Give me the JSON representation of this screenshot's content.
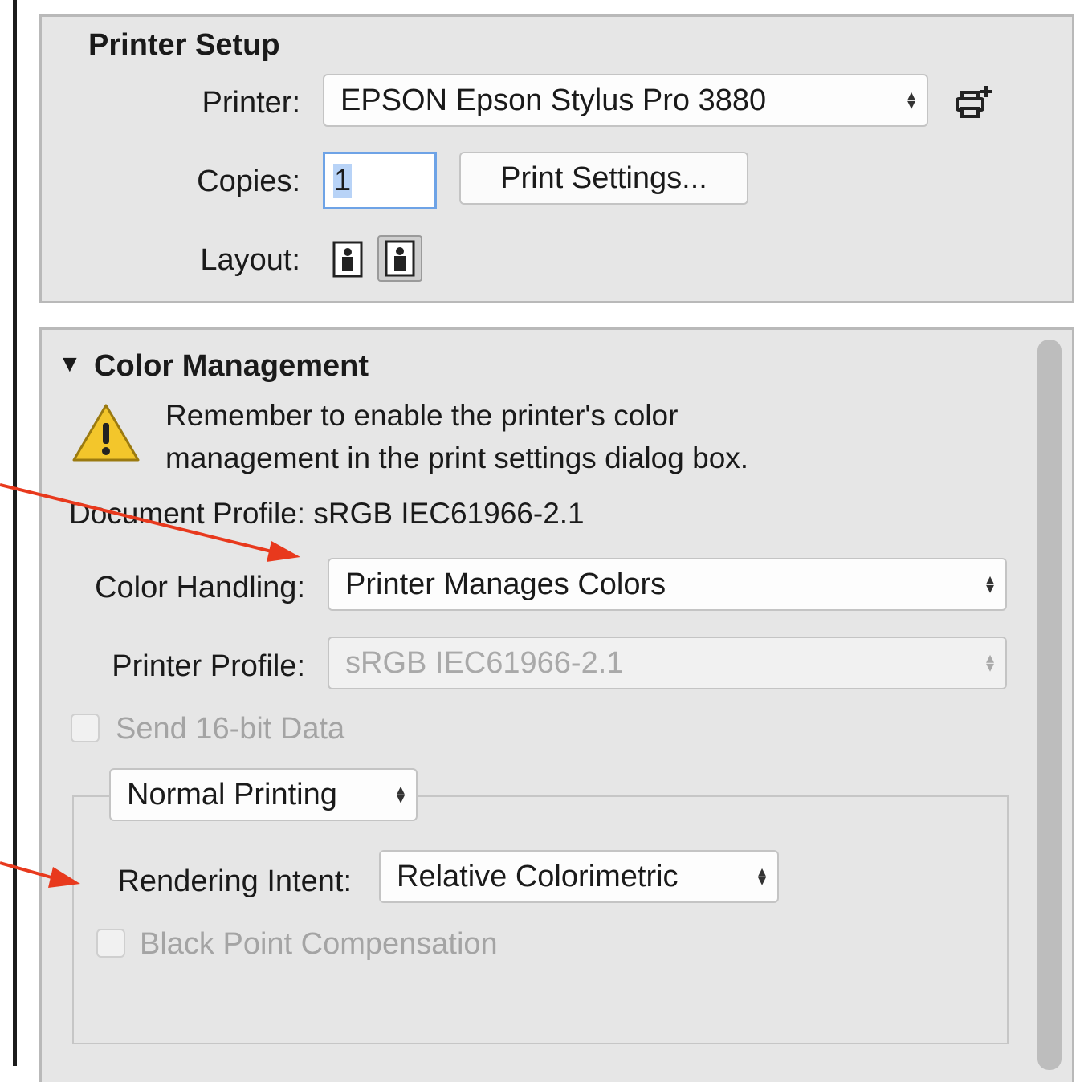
{
  "printer_setup": {
    "title": "Printer Setup",
    "printer_label": "Printer:",
    "printer_value": "EPSON Epson Stylus Pro 3880",
    "copies_label": "Copies:",
    "copies_value": "1",
    "print_settings_label": "Print Settings...",
    "layout_label": "Layout:"
  },
  "color_management": {
    "title": "Color Management",
    "disclosure": "▼",
    "warning_line1": "Remember to enable the printer's color",
    "warning_line2": "management in the print settings dialog box.",
    "document_profile": "Document Profile: sRGB IEC61966-2.1",
    "color_handling_label": "Color Handling:",
    "color_handling_value": "Printer Manages Colors",
    "printer_profile_label": "Printer Profile:",
    "printer_profile_value": "sRGB IEC61966-2.1",
    "send_16bit_label": "Send 16-bit Data",
    "printing_mode_value": "Normal Printing",
    "rendering_intent_label": "Rendering Intent:",
    "rendering_intent_value": "Relative Colorimetric",
    "black_point_label": "Black Point Compensation"
  },
  "colors": {
    "annotation_arrow": "#e8391d",
    "warning_yellow": "#f3c62b",
    "focus_blue": "#6ea3e6"
  }
}
